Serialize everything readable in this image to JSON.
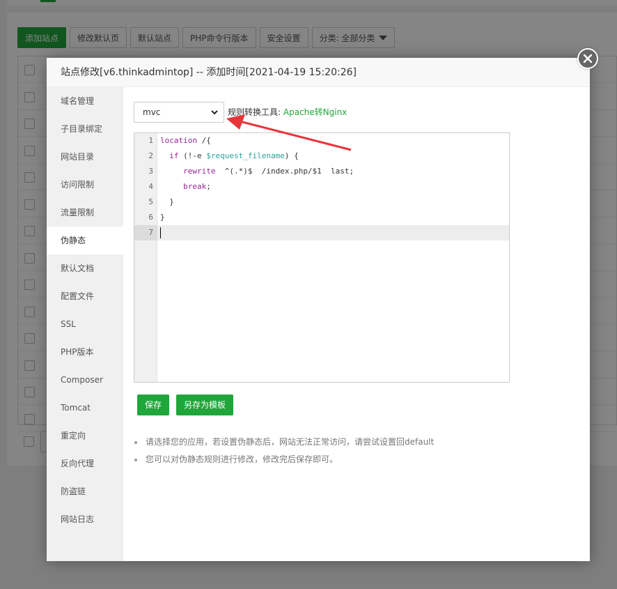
{
  "background": {
    "toolbar": [
      {
        "label": "添加站点",
        "primary": true
      },
      {
        "label": "修改默认页"
      },
      {
        "label": "默认站点"
      },
      {
        "label": "PHP命令行版本"
      },
      {
        "label": "安全设置"
      },
      {
        "label": "分类: 全部分类",
        "dropdown": true
      }
    ],
    "row_count": 14
  },
  "modal": {
    "title": "站点修改[v6.thinkadmintop] -- 添加时间[2021-04-19 15:20:26]",
    "close_icon": "close-icon",
    "sidebar": [
      "域名管理",
      "子目录绑定",
      "网站目录",
      "访问限制",
      "流量限制",
      "伪静态",
      "默认文档",
      "配置文件",
      "SSL",
      "PHP版本",
      "Composer",
      "Tomcat",
      "重定向",
      "反向代理",
      "防盗链",
      "网站日志"
    ],
    "sidebar_active": "伪静态",
    "template_select": {
      "value": "mvc"
    },
    "tool_label": "规则转换工具:",
    "tool_link": "Apache转Nginx",
    "editor": {
      "lines": [
        {
          "no": "1",
          "text": "location /{"
        },
        {
          "no": "2",
          "text": "  if (!-e $request_filename) {"
        },
        {
          "no": "3",
          "text": "     rewrite  ^(.*)$  /index.php/$1  last;"
        },
        {
          "no": "4",
          "text": "     break;"
        },
        {
          "no": "5",
          "text": "  }"
        },
        {
          "no": "6",
          "text": "}"
        },
        {
          "no": "7",
          "text": ""
        }
      ],
      "active_line": 7
    },
    "buttons": {
      "save": "保存",
      "save_as_template": "另存为模板"
    },
    "tips": [
      "请选择您的应用，若设置伪静态后，网站无法正常访问，请尝试设置回default",
      "您可以对伪静态规则进行修改，修改完后保存即可。"
    ]
  },
  "colors": {
    "accent": "#20a53a",
    "annotation_arrow": "#e8353a"
  }
}
